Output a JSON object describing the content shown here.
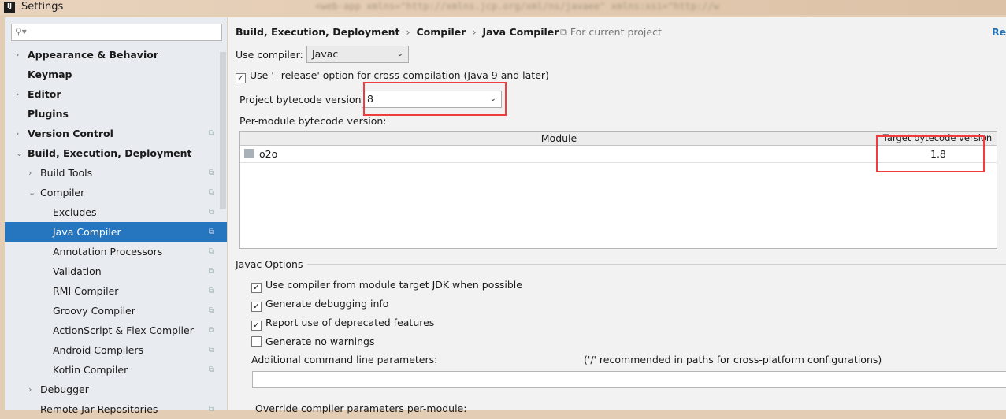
{
  "window": {
    "title": "Settings",
    "logo": "IJ",
    "background_text": "<web-app xmlns=\"http://xmlns.jcp.org/xml/ns/javaee\" xmlns:xsi=\"http://w"
  },
  "search": {
    "icon": "search-icon",
    "value": ""
  },
  "sidebar": {
    "items": [
      {
        "label": "Appearance & Behavior",
        "bold": true,
        "arrow": "right",
        "level": 0
      },
      {
        "label": "Keymap",
        "bold": true,
        "level": 0
      },
      {
        "label": "Editor",
        "bold": true,
        "arrow": "right",
        "level": 0
      },
      {
        "label": "Plugins",
        "bold": true,
        "level": 0
      },
      {
        "label": "Version Control",
        "bold": true,
        "arrow": "right",
        "level": 0,
        "copy": true
      },
      {
        "label": "Build, Execution, Deployment",
        "bold": true,
        "arrow": "down",
        "level": 0
      },
      {
        "label": "Build Tools",
        "arrow": "right",
        "level": 1,
        "copy": true
      },
      {
        "label": "Compiler",
        "arrow": "down",
        "level": 1,
        "copy": true
      },
      {
        "label": "Excludes",
        "level": 2,
        "copy": true
      },
      {
        "label": "Java Compiler",
        "level": 2,
        "copy": true,
        "selected": true
      },
      {
        "label": "Annotation Processors",
        "level": 2,
        "copy": true
      },
      {
        "label": "Validation",
        "level": 2,
        "copy": true
      },
      {
        "label": "RMI Compiler",
        "level": 2,
        "copy": true
      },
      {
        "label": "Groovy Compiler",
        "level": 2,
        "copy": true
      },
      {
        "label": "ActionScript & Flex Compiler",
        "level": 2,
        "copy": true
      },
      {
        "label": "Android Compilers",
        "level": 2,
        "copy": true
      },
      {
        "label": "Kotlin Compiler",
        "level": 2,
        "copy": true
      },
      {
        "label": "Debugger",
        "arrow": "right",
        "level": 1
      },
      {
        "label": "Remote Jar Repositories",
        "level": 1,
        "copy": true
      }
    ]
  },
  "breadcrumb": [
    "Build, Execution, Deployment",
    "Compiler",
    "Java Compiler"
  ],
  "scope": "For current project",
  "reset": "Reset",
  "use_compiler": {
    "label": "Use compiler:",
    "value": "Javac"
  },
  "release_option": {
    "label": "Use '--release' option for cross-compilation (Java 9 and later)",
    "checked": true
  },
  "project_bytecode": {
    "label": "Project bytecode version",
    "value": "8"
  },
  "per_module": {
    "label": "Per-module bytecode version:",
    "columns": [
      "Module",
      "Target bytecode version"
    ],
    "rows": [
      {
        "module": "o2o",
        "version": "1.8"
      }
    ]
  },
  "javac": {
    "title": "Javac Options",
    "options": [
      {
        "label": "Use compiler from module target JDK when possible",
        "checked": true
      },
      {
        "label": "Generate debugging info",
        "checked": true
      },
      {
        "label": "Report use of deprecated features",
        "checked": true
      },
      {
        "label": "Generate no warnings",
        "checked": false
      }
    ],
    "additional_label": "Additional command line parameters:",
    "additional_hint": "('/' recommended in paths for cross-platform configurations)",
    "additional_value": "",
    "override_label": "Override compiler parameters per-module:"
  },
  "highlight_color": "#f03c3c",
  "selection_color": "#2675bf"
}
